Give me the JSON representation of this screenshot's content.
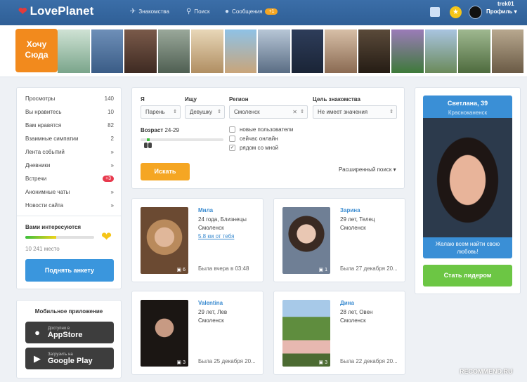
{
  "header": {
    "logo": "LovePlanet",
    "nav": [
      {
        "label": "Знакомства",
        "icon": "bird-icon"
      },
      {
        "label": "Поиск",
        "icon": "search-icon"
      },
      {
        "label": "Сообщения",
        "icon": "chat-icon",
        "badge": "+1"
      }
    ],
    "profile": "Профиль",
    "username": "trek01",
    "colors": {
      "bar": "#3466a0",
      "badge": "#f5a623"
    }
  },
  "strip": {
    "cta": "Хочу Сюда",
    "thumb_count": 14
  },
  "left_menu": [
    {
      "label": "Просмотры",
      "value": "140"
    },
    {
      "label": "Вы нравитесь",
      "value": "10"
    },
    {
      "label": "Вам нравятся",
      "value": "82"
    },
    {
      "label": "Взаимные симпатии",
      "value": "2"
    },
    {
      "label": "Лента событий",
      "value": "»"
    },
    {
      "label": "Дневники",
      "value": "»"
    },
    {
      "label": "Встречи",
      "value": "+3"
    },
    {
      "label": "Анонимные чаты",
      "value": "»"
    },
    {
      "label": "Новости сайта",
      "value": "»"
    }
  ],
  "interest": {
    "title": "Вами интересуются",
    "progress": 0.45,
    "place": "10 241 место",
    "button": "Поднять анкету"
  },
  "mobile": {
    "title": "Мобильное приложение",
    "appstore_small": "Доступно в",
    "appstore_big": "AppStore",
    "gplay_small": "Загрузить на",
    "gplay_big": "Google Play"
  },
  "search": {
    "i_label": "Я",
    "i_value": "Парень",
    "seek_label": "Ищу",
    "seek_value": "Девушку",
    "region_label": "Регион",
    "region_value": "Смоленск",
    "goal_label": "Цель знакомства",
    "goal_value": "Не имеет значения",
    "age_label": "Возраст",
    "age_value": "24-29",
    "checkboxes": [
      {
        "label": "новые пользователи",
        "checked": false
      },
      {
        "label": "сейчас онлайн",
        "checked": false
      },
      {
        "label": "рядом со мной",
        "checked": true
      }
    ],
    "button": "Искать",
    "advanced": "Расширенный поиск"
  },
  "profiles": [
    {
      "name": "Мила",
      "line1": "24 года, Близнецы",
      "city": "Смоленск",
      "distance": "5.8 км от тебя",
      "seen": "Была вчера в 03:48",
      "photos": "6"
    },
    {
      "name": "Зарина",
      "line1": "29 лет, Телец",
      "city": "Смоленск",
      "distance": "",
      "seen": "Была 27 декабря 20...",
      "photos": "1"
    },
    {
      "name": "Valentina",
      "line1": "29 лет, Лев",
      "city": "Смоленск",
      "distance": "",
      "seen": "Была 25 декабря 20...",
      "photos": "3"
    },
    {
      "name": "Дина",
      "line1": "28 лет, Овен",
      "city": "Смоленск",
      "distance": "",
      "seen": "Была 22 декабря 20...",
      "photos": "3"
    }
  ],
  "leader": {
    "name": "Светлана, 39",
    "city": "Красноканенск",
    "message": "Желаю всем найти свою любовь!",
    "button": "Стать лидером"
  },
  "watermark": "RECOMMEND.RU"
}
